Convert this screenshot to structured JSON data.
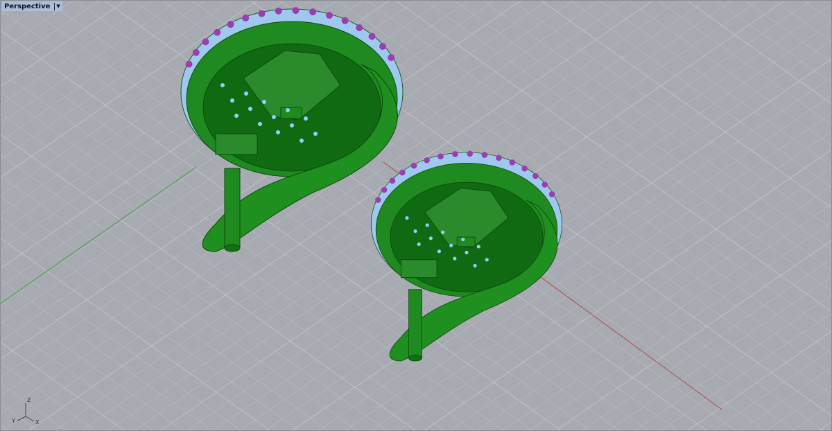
{
  "viewport": {
    "name": "Perspective",
    "menu_icon": "triangle-down-icon"
  },
  "axes": {
    "x": "X",
    "y": "Y",
    "z": "Z"
  },
  "colors": {
    "background": "#a7abb1",
    "grid": "#b9bdc2",
    "x_axis": "#b0484a",
    "y_axis": "#3f9a3f",
    "model": "#1f8a1f",
    "stones": "#9fc8ef",
    "prongs": "#9a3fb0"
  }
}
